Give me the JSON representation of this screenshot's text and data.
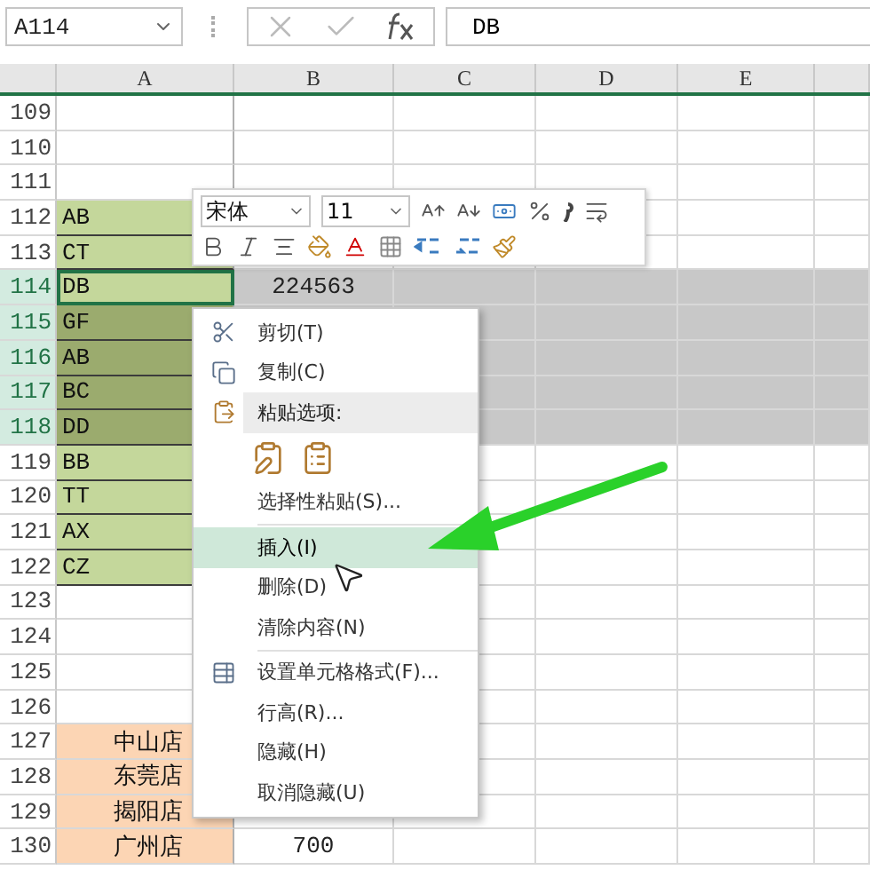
{
  "formula_bar": {
    "name_box": "A114",
    "formula": "DB"
  },
  "columns": [
    "A",
    "B",
    "C",
    "D",
    "E"
  ],
  "rows": [
    {
      "number": "109",
      "selected": false,
      "active": false,
      "a": {
        "kind": "empty"
      }
    },
    {
      "number": "110",
      "selected": false,
      "active": false,
      "a": {
        "kind": "empty"
      }
    },
    {
      "number": "111",
      "selected": false,
      "active": false,
      "a": {
        "kind": "empty"
      }
    },
    {
      "number": "112",
      "selected": false,
      "active": false,
      "a": {
        "text": "AB",
        "kind": "tag"
      }
    },
    {
      "number": "113",
      "selected": false,
      "active": false,
      "a": {
        "text": "CT",
        "kind": "tag"
      }
    },
    {
      "number": "114",
      "selected": true,
      "active": true,
      "a": {
        "text": "DB",
        "kind": "tag"
      },
      "b": "224563"
    },
    {
      "number": "115",
      "selected": true,
      "active": false,
      "a": {
        "text": "GF",
        "kind": "tag"
      }
    },
    {
      "number": "116",
      "selected": true,
      "active": false,
      "a": {
        "text": "AB",
        "kind": "tag"
      }
    },
    {
      "number": "117",
      "selected": true,
      "active": false,
      "a": {
        "text": "BC",
        "kind": "tag"
      }
    },
    {
      "number": "118",
      "selected": true,
      "active": false,
      "a": {
        "text": "DD",
        "kind": "tag"
      }
    },
    {
      "number": "119",
      "selected": false,
      "active": false,
      "a": {
        "text": "BB",
        "kind": "tag"
      }
    },
    {
      "number": "120",
      "selected": false,
      "active": false,
      "a": {
        "text": "TT",
        "kind": "tag"
      }
    },
    {
      "number": "121",
      "selected": false,
      "active": false,
      "a": {
        "text": "AX",
        "kind": "tag"
      }
    },
    {
      "number": "122",
      "selected": false,
      "active": false,
      "a": {
        "text": "CZ",
        "kind": "tag"
      }
    },
    {
      "number": "123",
      "selected": false,
      "active": false,
      "a": {
        "kind": "empty"
      }
    },
    {
      "number": "124",
      "selected": false,
      "active": false,
      "a": {
        "kind": "empty"
      }
    },
    {
      "number": "125",
      "selected": false,
      "active": false,
      "a": {
        "kind": "empty"
      }
    },
    {
      "number": "126",
      "selected": false,
      "active": false,
      "a": {
        "kind": "empty"
      }
    },
    {
      "number": "127",
      "selected": false,
      "active": false,
      "a": {
        "text": "中山店",
        "kind": "store"
      }
    },
    {
      "number": "128",
      "selected": false,
      "active": false,
      "a": {
        "text": "东莞店",
        "kind": "store"
      }
    },
    {
      "number": "129",
      "selected": false,
      "active": false,
      "a": {
        "text": "揭阳店",
        "kind": "store"
      }
    },
    {
      "number": "130",
      "selected": false,
      "active": false,
      "a": {
        "text": "广州店",
        "kind": "store"
      },
      "b": "700"
    }
  ],
  "mini_toolbar": {
    "font": "宋体",
    "size": "11"
  },
  "context_menu": [
    {
      "kind": "item",
      "label": "剪切(T)",
      "selected": false
    },
    {
      "kind": "item",
      "label": "复制(C)",
      "selected": false
    },
    {
      "kind": "header",
      "label": "粘贴选项:"
    },
    {
      "kind": "paste-options"
    },
    {
      "kind": "item",
      "label": "选择性粘贴(S)...",
      "selected": false
    },
    {
      "kind": "separator"
    },
    {
      "kind": "item",
      "label": "插入(I)",
      "selected": true
    },
    {
      "kind": "item",
      "label": "删除(D)",
      "selected": false
    },
    {
      "kind": "item",
      "label": "清除内容(N)",
      "selected": false
    },
    {
      "kind": "separator"
    },
    {
      "kind": "item",
      "label": "设置单元格格式(F)...",
      "selected": false
    },
    {
      "kind": "item",
      "label": "行高(R)...",
      "selected": false
    },
    {
      "kind": "item",
      "label": "隐藏(H)",
      "selected": false
    },
    {
      "kind": "item",
      "label": "取消隐藏(U)",
      "selected": false
    }
  ]
}
